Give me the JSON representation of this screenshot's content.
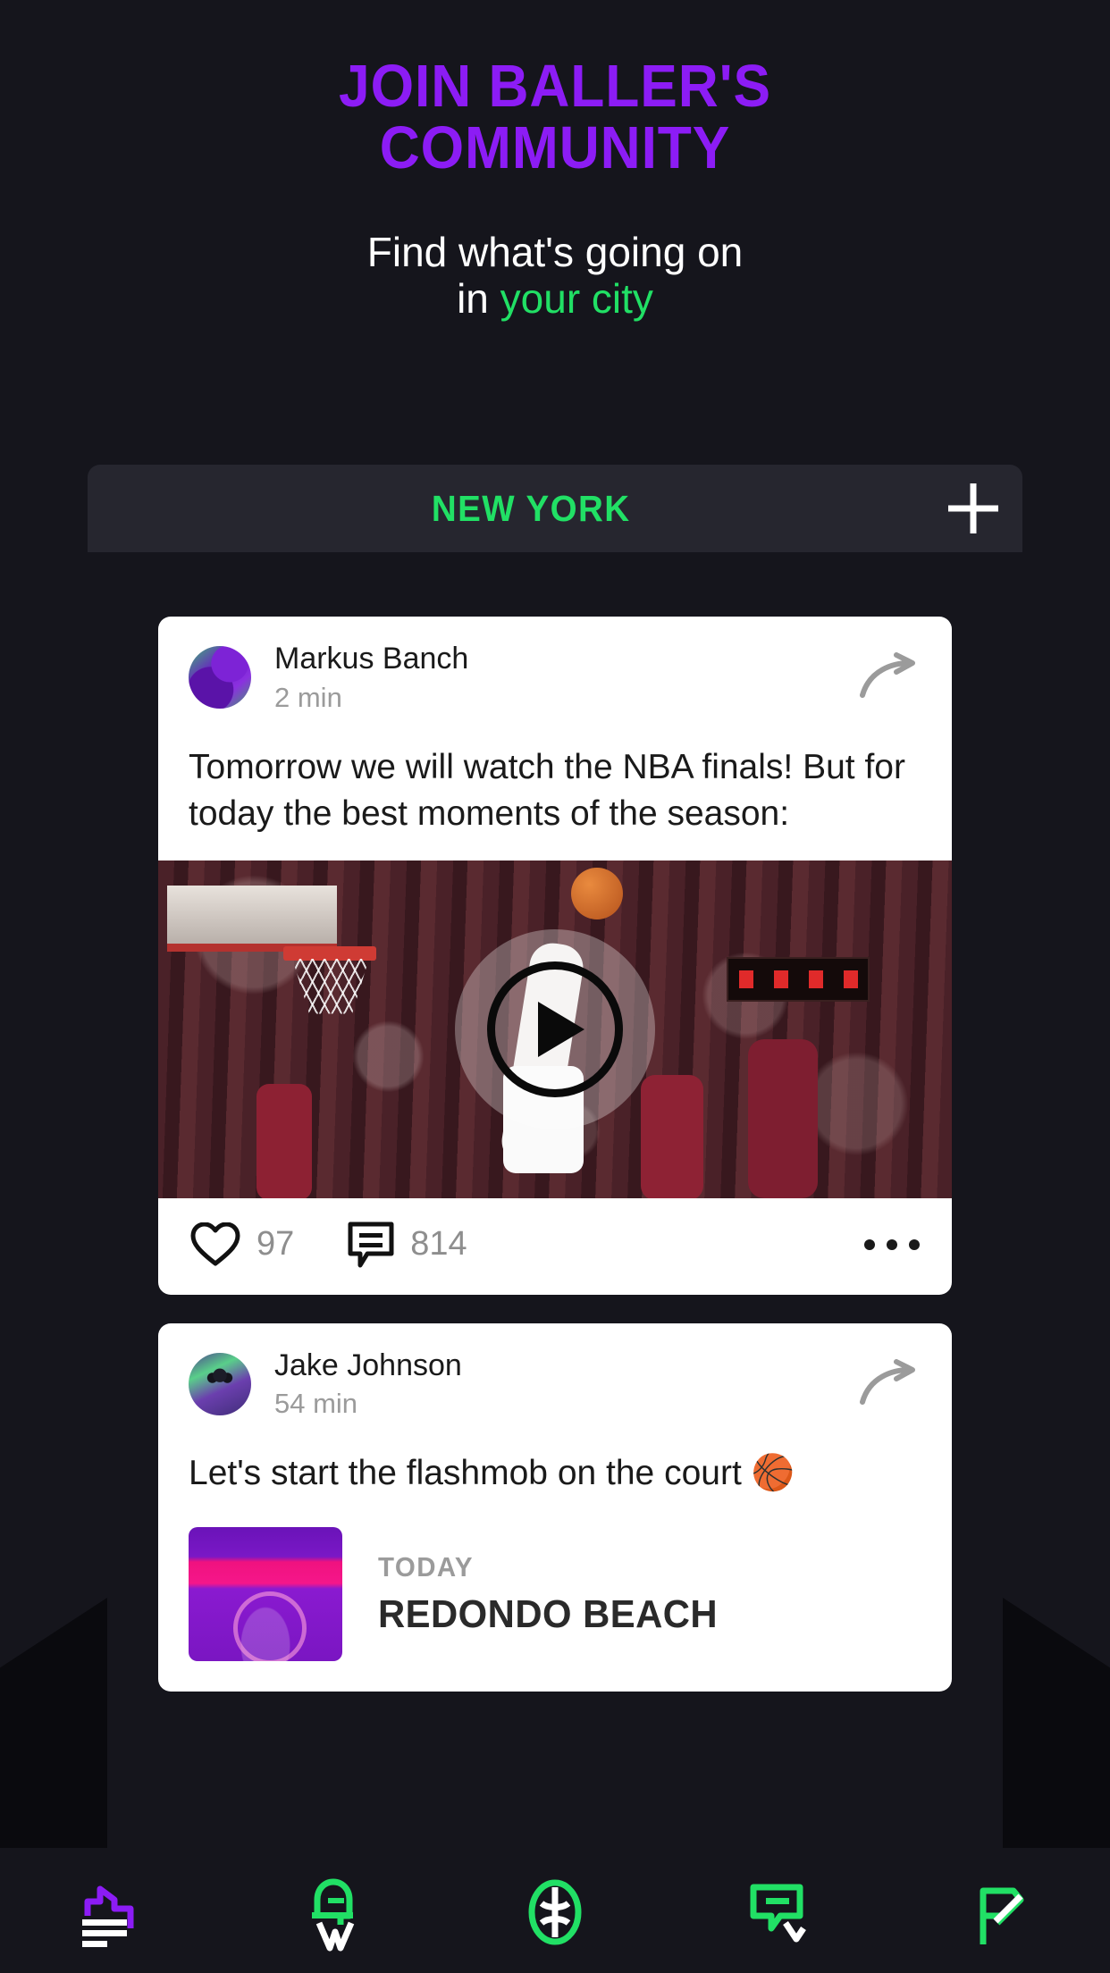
{
  "hero": {
    "title_line1": "JOIN BALLER'S",
    "title_line2": "COMMUNITY",
    "subtitle_line1": "Find what's going on",
    "subtitle_prefix": "in ",
    "subtitle_accent": "your city",
    "title_color": "#8c1cf5",
    "accent_color": "#21e065"
  },
  "city_selector": {
    "city": "NEW YORK",
    "add_label": "+"
  },
  "feed": {
    "posts": [
      {
        "author": "Markus Banch",
        "time": "2 min",
        "text": "Tomorrow we will watch the NBA finals! But for today the best moments of the season:",
        "likes": "97",
        "comments": "814",
        "share_icon": "share-arrow-icon",
        "more_icon": "more-options-icon",
        "media_type": "video",
        "play_icon": "play-icon"
      },
      {
        "author": "Jake Johnson",
        "time": "54 min",
        "text": "Let's start the flashmob on the court 🏀",
        "share_icon": "share-arrow-icon",
        "event": {
          "day": "TODAY",
          "title": "REDONDO BEACH"
        }
      }
    ]
  },
  "bottom_nav": {
    "items": [
      {
        "name": "feed-icon",
        "color": "#8c1cf5"
      },
      {
        "name": "whistle-icon",
        "color": "#21e065"
      },
      {
        "name": "ball-icon",
        "color": "#21e065"
      },
      {
        "name": "chat-icon",
        "color": "#21e065"
      },
      {
        "name": "profile-icon",
        "color": "#21e065"
      }
    ]
  }
}
